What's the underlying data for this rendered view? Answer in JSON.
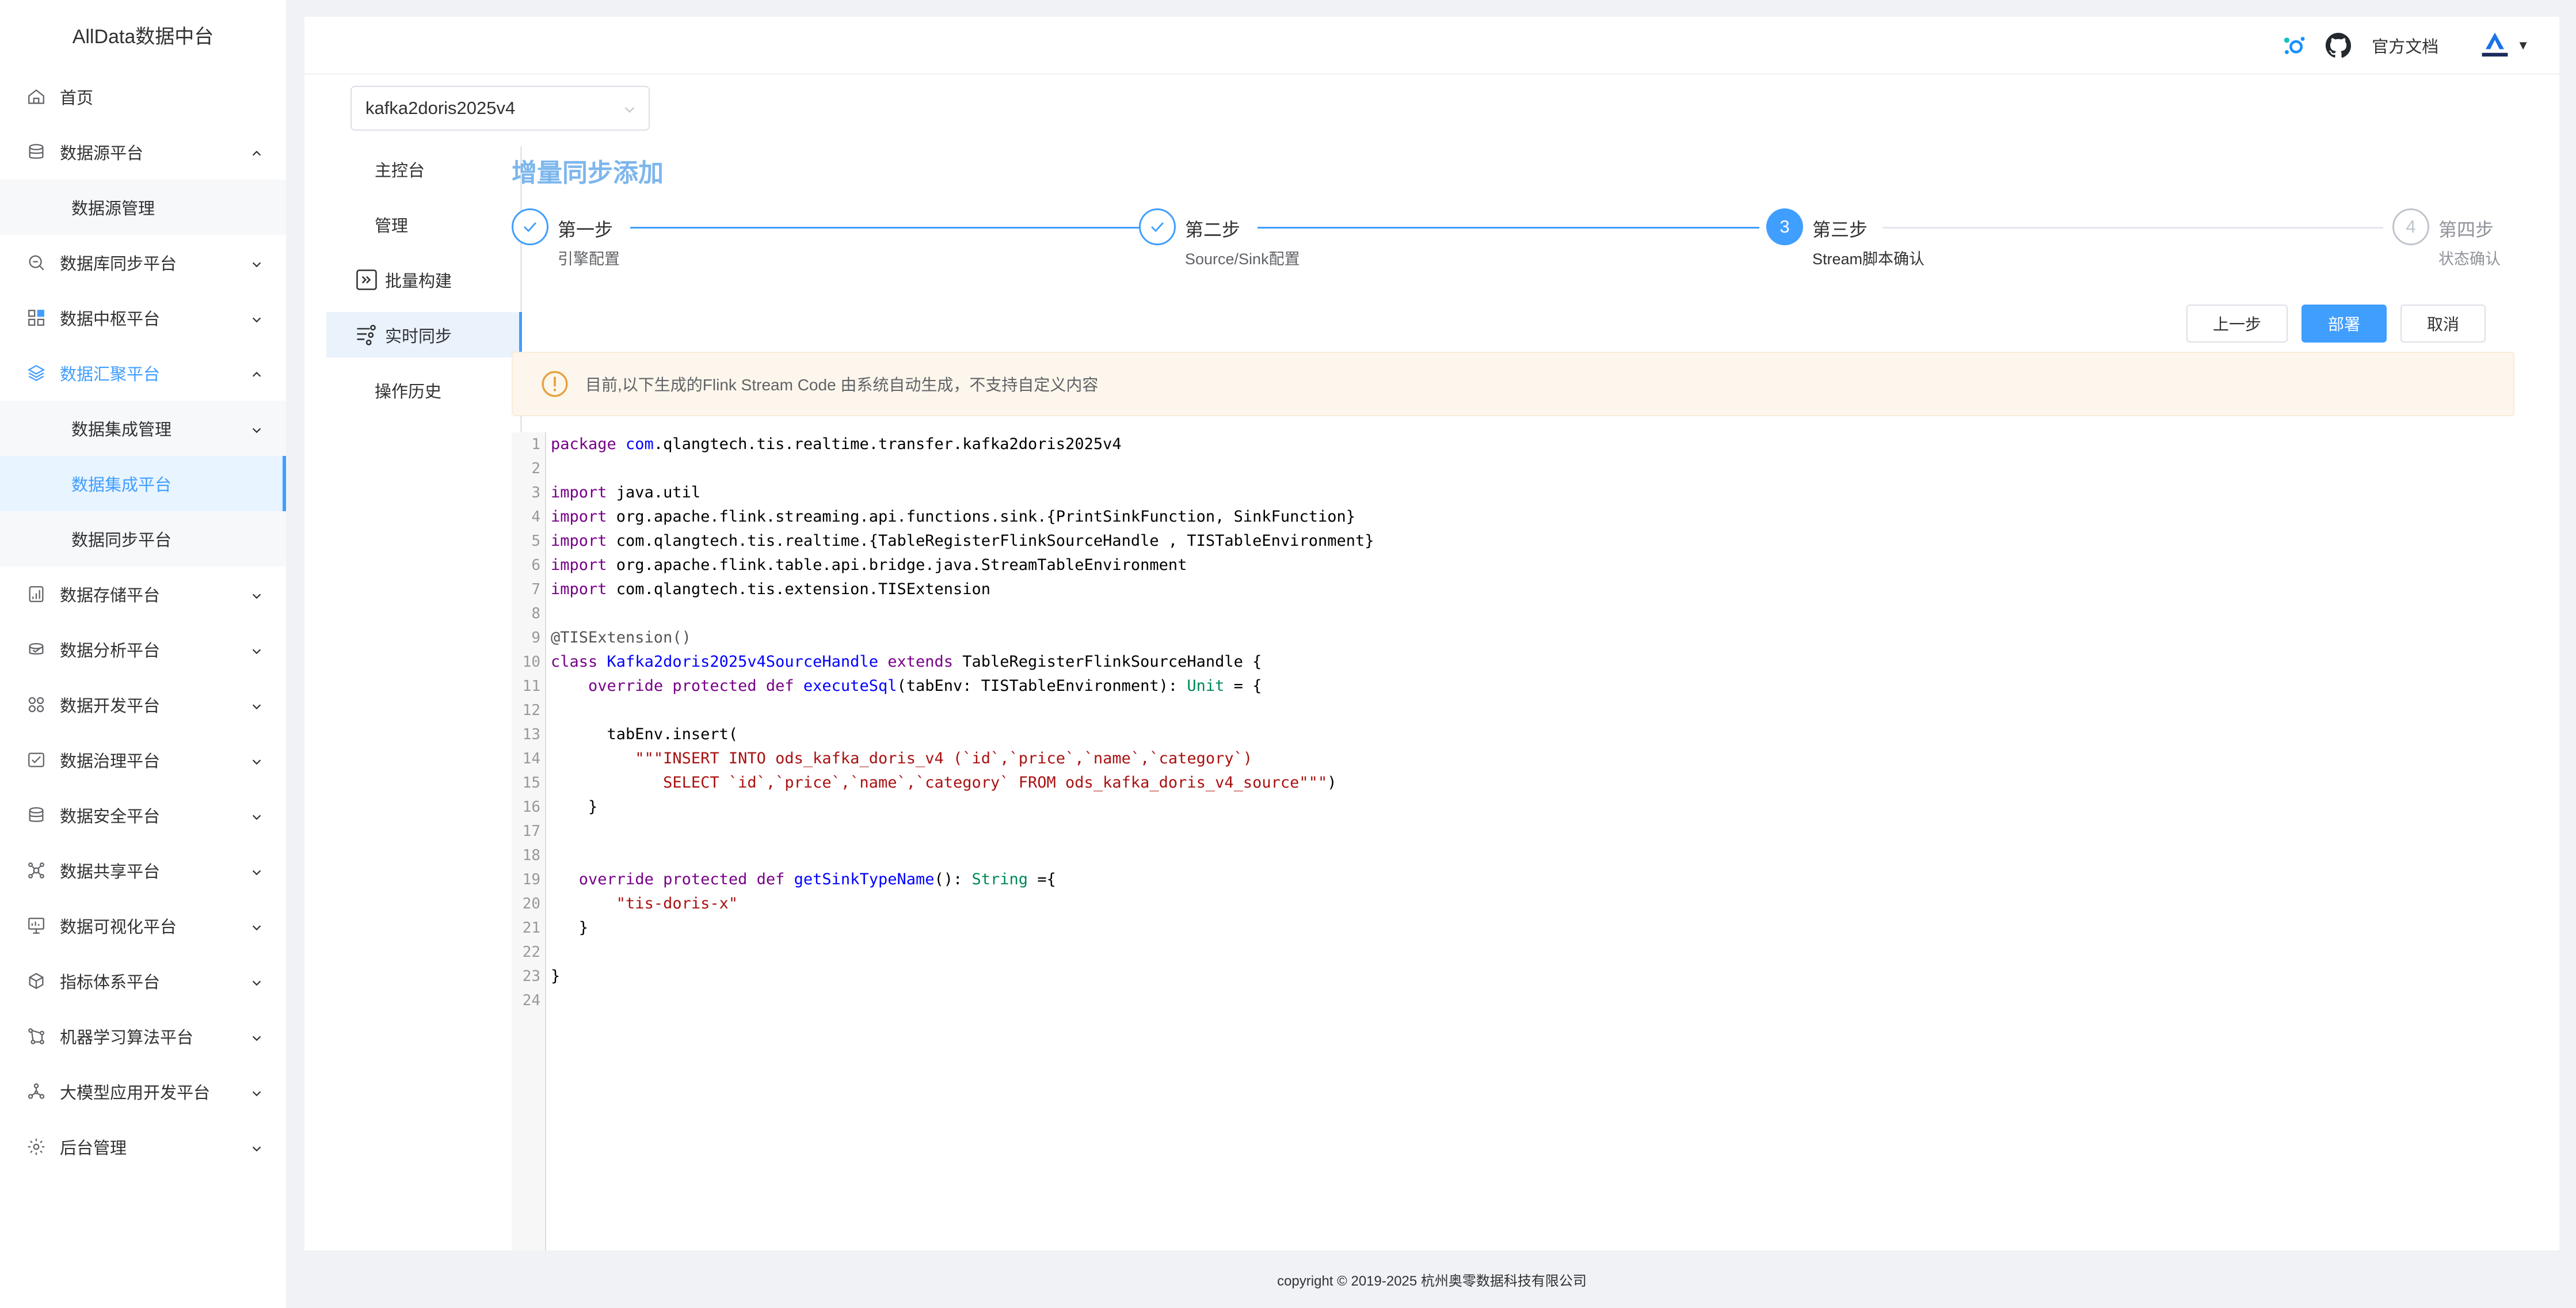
{
  "app": {
    "title": "AllData数据中台"
  },
  "sidebar": {
    "items": [
      {
        "label": "首页",
        "icon": "home-icon"
      },
      {
        "label": "数据源平台",
        "icon": "database-icon",
        "expanded": true,
        "children": [
          {
            "label": "数据源管理"
          }
        ]
      },
      {
        "label": "数据库同步平台",
        "icon": "db-sync-icon"
      },
      {
        "label": "数据中枢平台",
        "icon": "hub-icon"
      },
      {
        "label": "数据汇聚平台",
        "icon": "layers-icon",
        "expanded": true,
        "active": true,
        "children": [
          {
            "label": "数据集成管理",
            "has_arrow": true
          },
          {
            "label": "数据集成平台",
            "selected": true
          },
          {
            "label": "数据同步平台"
          }
        ]
      },
      {
        "label": "数据存储平台",
        "icon": "storage-icon"
      },
      {
        "label": "数据分析平台",
        "icon": "analysis-icon"
      },
      {
        "label": "数据开发平台",
        "icon": "dev-icon"
      },
      {
        "label": "数据治理平台",
        "icon": "governance-icon"
      },
      {
        "label": "数据安全平台",
        "icon": "security-icon"
      },
      {
        "label": "数据共享平台",
        "icon": "share-icon"
      },
      {
        "label": "数据可视化平台",
        "icon": "visual-icon"
      },
      {
        "label": "指标体系平台",
        "icon": "metric-icon"
      },
      {
        "label": "机器学习算法平台",
        "icon": "ml-icon"
      },
      {
        "label": "大模型应用开发平台",
        "icon": "llm-icon"
      },
      {
        "label": "后台管理",
        "icon": "admin-icon"
      }
    ]
  },
  "header": {
    "doc_link": "官方文档"
  },
  "pipeline": {
    "selected": "kafka2doris2025v4"
  },
  "left_nav": {
    "items": [
      {
        "label": "主控台"
      },
      {
        "label": "管理"
      },
      {
        "label": "批量构建",
        "icon": "batch-build-icon"
      },
      {
        "label": "实时同步",
        "icon": "realtime-sync-icon",
        "active": true
      },
      {
        "label": "操作历史"
      }
    ]
  },
  "wizard": {
    "title": "增量同步添加",
    "steps": [
      {
        "title": "第一步",
        "desc": "引擎配置",
        "status": "done"
      },
      {
        "title": "第二步",
        "desc": "Source/Sink配置",
        "status": "done"
      },
      {
        "title": "第三步",
        "desc": "Stream脚本确认",
        "status": "current",
        "number": "3"
      },
      {
        "title": "第四步",
        "desc": "状态确认",
        "status": "todo",
        "number": "4"
      }
    ],
    "buttons": {
      "prev": "上一步",
      "deploy": "部署",
      "cancel": "取消"
    },
    "alert": "目前,以下生成的Flink Stream Code 由系统自动生成，不支持自定义内容"
  },
  "editor": {
    "lines": [
      [
        [
          "kw",
          "package "
        ],
        [
          "def",
          "com"
        ],
        [
          "pl",
          ".qlangtech.tis.realtime.transfer.kafka2doris2025v4"
        ]
      ],
      [],
      [
        [
          "kw",
          "import "
        ],
        [
          "pl",
          "java.util"
        ]
      ],
      [
        [
          "kw",
          "import "
        ],
        [
          "pl",
          "org.apache.flink.streaming.api.functions.sink.{PrintSinkFunction, SinkFunction}"
        ]
      ],
      [
        [
          "kw",
          "import "
        ],
        [
          "pl",
          "com.qlangtech.tis.realtime.{TableRegisterFlinkSourceHandle , TISTableEnvironment}"
        ]
      ],
      [
        [
          "kw",
          "import "
        ],
        [
          "pl",
          "org.apache.flink.table.api.bridge.java.StreamTableEnvironment"
        ]
      ],
      [
        [
          "kw",
          "import "
        ],
        [
          "pl",
          "com.qlangtech.tis.extension.TISExtension"
        ]
      ],
      [],
      [
        [
          "ann",
          "@TISExtension()"
        ]
      ],
      [
        [
          "kw",
          "class "
        ],
        [
          "def",
          "Kafka2doris2025v4SourceHandle"
        ],
        [
          "kw",
          " extends "
        ],
        [
          "pl",
          "TableRegisterFlinkSourceHandle {"
        ]
      ],
      [
        [
          "pl",
          "    "
        ],
        [
          "kw",
          "override protected def "
        ],
        [
          "def",
          "executeSql"
        ],
        [
          "pl",
          "(tabEnv: TISTableEnvironment): "
        ],
        [
          "type",
          "Unit"
        ],
        [
          "pl",
          " = {"
        ]
      ],
      [],
      [
        [
          "pl",
          "      tabEnv.insert("
        ]
      ],
      [
        [
          "pl",
          "         "
        ],
        [
          "str",
          "\"\"\"INSERT INTO ods_kafka_doris_v4 (`id`,`price`,`name`,`category`)"
        ]
      ],
      [
        [
          "str",
          "            SELECT `id`,`price`,`name`,`category` FROM ods_kafka_doris_v4_source\"\"\""
        ],
        [
          "pl",
          ")"
        ]
      ],
      [
        [
          "pl",
          "    }"
        ]
      ],
      [],
      [],
      [
        [
          "pl",
          "   "
        ],
        [
          "kw",
          "override protected def "
        ],
        [
          "def",
          "getSinkTypeName"
        ],
        [
          "pl",
          "(): "
        ],
        [
          "type",
          "String"
        ],
        [
          "pl",
          " ={"
        ]
      ],
      [
        [
          "pl",
          "       "
        ],
        [
          "str",
          "\"tis-doris-x\""
        ]
      ],
      [
        [
          "pl",
          "   }"
        ]
      ],
      [],
      [
        [
          "pl",
          "}"
        ]
      ],
      []
    ]
  },
  "footer": {
    "copyright": "copyright © 2019-2025 杭州奥零数据科技有限公司"
  },
  "colors": {
    "primary": "#409eff",
    "alert_bg": "#fdf6ec",
    "warning": "#e6a23c",
    "title": "#7db6ec"
  }
}
